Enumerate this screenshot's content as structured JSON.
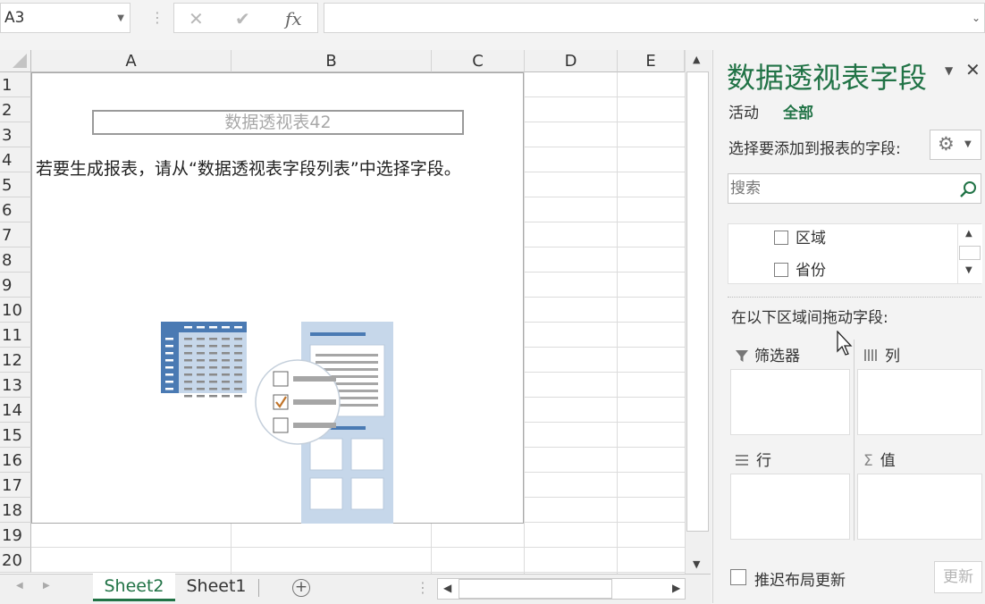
{
  "formula_bar": {
    "name_box": "A3",
    "cancel_icon": "✕",
    "enter_icon": "✔",
    "fx_icon": "fx",
    "formula_value": ""
  },
  "grid": {
    "columns": [
      "A",
      "B",
      "C",
      "D",
      "E"
    ],
    "rows": [
      "1",
      "2",
      "3",
      "4",
      "5",
      "6",
      "7",
      "8",
      "9",
      "10",
      "11",
      "12",
      "13",
      "14",
      "15",
      "16",
      "17",
      "18",
      "19",
      "20"
    ]
  },
  "pivot": {
    "name": "数据透视表42",
    "hint": "若要生成报表，请从“数据透视表字段列表”中选择字段。"
  },
  "sheets": {
    "tabs": [
      "Sheet2",
      "Sheet1"
    ],
    "active": "Sheet2",
    "add_icon": "+"
  },
  "pane": {
    "title": "数据透视表字段",
    "tab_active": "活动",
    "tab_all": "全部",
    "choose_label": "选择要添加到报表的字段:",
    "search_placeholder": "搜索",
    "fields": [
      "区域",
      "省份"
    ],
    "drag_label": "在以下区域间拖动字段:",
    "zones": {
      "filters": "筛选器",
      "columns": "列",
      "rows": "行",
      "values": "值"
    },
    "defer_label": "推迟布局更新",
    "update_button": "更新"
  },
  "colors": {
    "accent": "#217346",
    "pivot_icon_dark": "#4a7ab3",
    "pivot_icon_light": "#c6d7ea",
    "check_orange": "#c0742a"
  }
}
